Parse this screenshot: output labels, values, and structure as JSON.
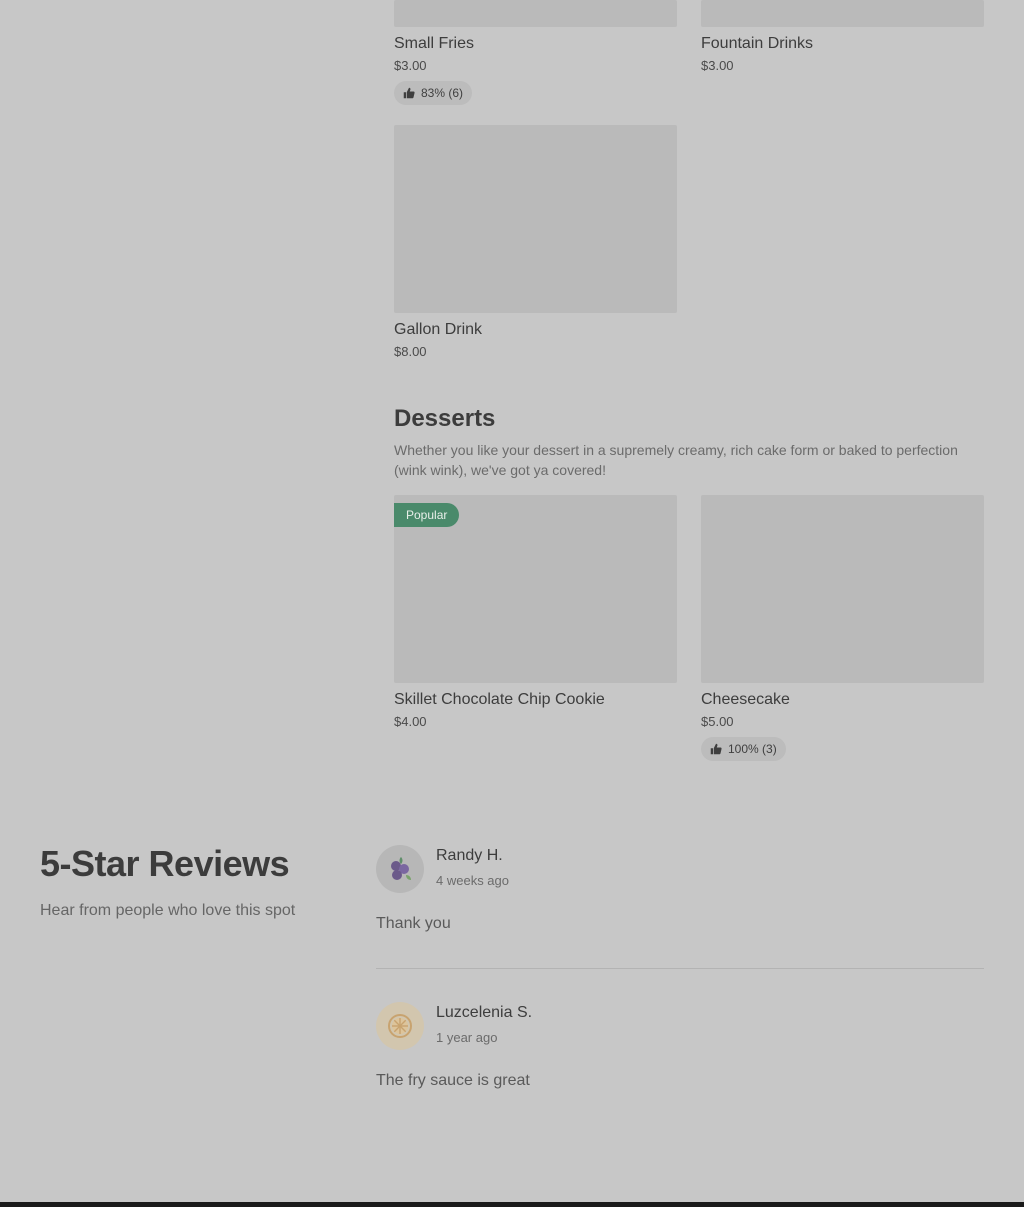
{
  "menu": {
    "items": [
      {
        "title": "Small Fries",
        "price": "$3.00",
        "rating": "83% (6)"
      },
      {
        "title": "Fountain Drinks",
        "price": "$3.00"
      },
      {
        "title": "Gallon Drink",
        "price": "$8.00"
      }
    ],
    "desserts": {
      "title": "Desserts",
      "description": "Whether you like your dessert in a supremely creamy, rich cake form or baked to perfection (wink wink), we've got ya covered!",
      "items": [
        {
          "title": "Skillet Chocolate Chip Cookie",
          "price": "$4.00",
          "badge": "Popular"
        },
        {
          "title": "Cheesecake",
          "price": "$5.00",
          "rating": "100% (3)"
        }
      ]
    }
  },
  "reviews": {
    "title": "5-Star Reviews",
    "subtitle": "Hear from people who love this spot",
    "list": [
      {
        "name": "Randy H.",
        "date": "4 weeks ago",
        "text": "Thank you",
        "avatar_icon": "blueberry-icon"
      },
      {
        "name": "Luzcelenia S.",
        "date": "1 year ago",
        "text": "The fry sauce is great",
        "avatar_icon": "orange-slice-icon"
      }
    ]
  },
  "colors": {
    "background": "#c7c7c7",
    "placeholder": "#bababa",
    "badge": "#4a8a6b"
  }
}
